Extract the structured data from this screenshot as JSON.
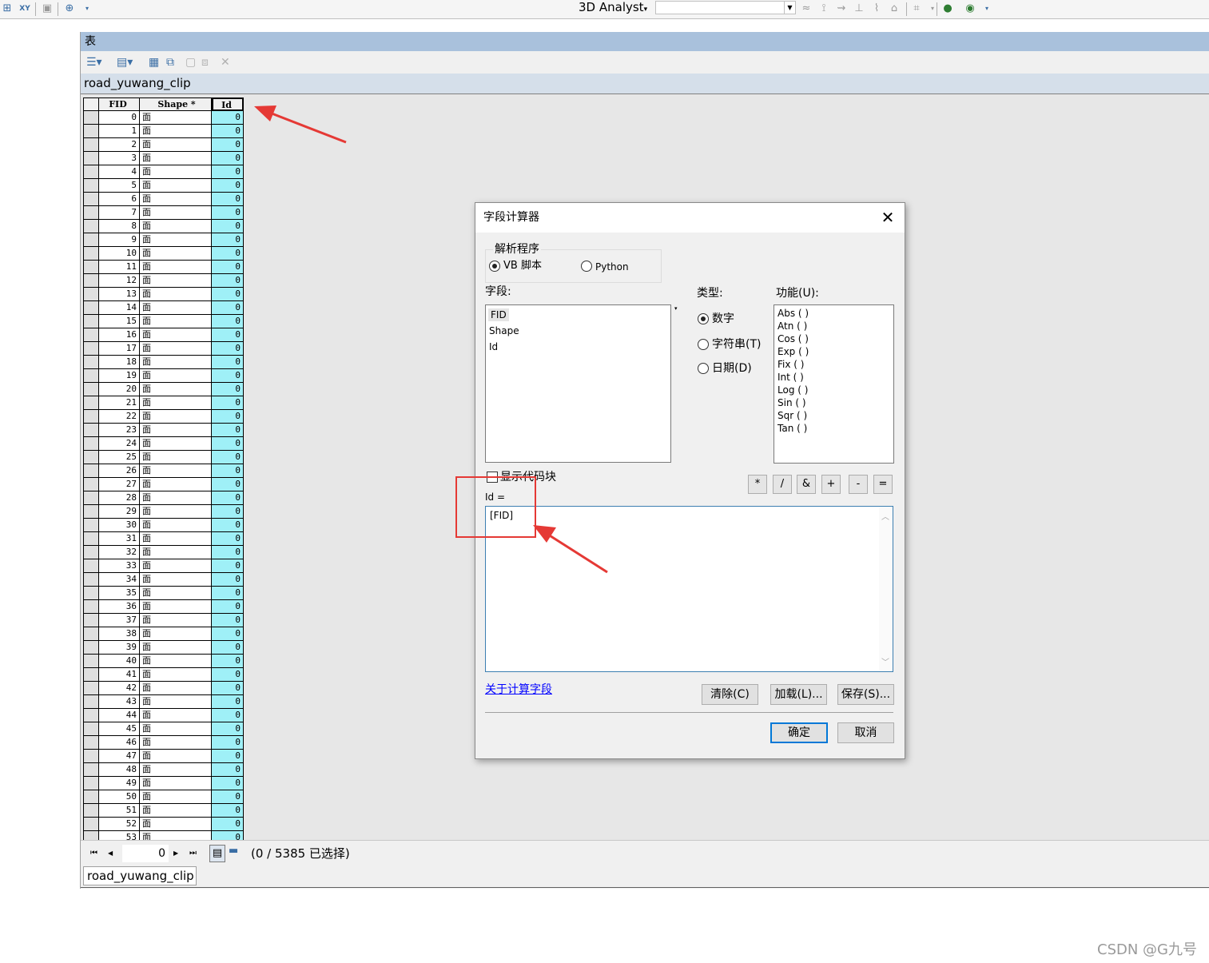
{
  "toolbar": {
    "analyst_label": "3D Analyst",
    "analyst_dropdown_arrow": "▾",
    "icons": [
      "add-xy-icon",
      "xy-icon",
      "identify-icon",
      "zoom-icon",
      "interpolate-icon",
      "globe-icon",
      "arcscene-icon"
    ]
  },
  "table_window": {
    "title": "表",
    "tab_header": "road_yuwang_clip",
    "bottom_tab": "road_yuwang_clip",
    "columns": [
      "FID",
      "Shape *",
      "Id"
    ],
    "shape_value": "面",
    "id_value": "0",
    "row_count_visible": 54,
    "nav": {
      "first": "⏮",
      "prev": "◀",
      "record": "0",
      "next": "▶",
      "last": "⏭",
      "status": "(0 / 5385 已选择)"
    }
  },
  "dialog": {
    "title": "字段计算器",
    "close_glyph": "✕",
    "parser_label": "解析程序",
    "parser_options": [
      "VB 脚本",
      "Python"
    ],
    "parser_selected": "VB 脚本",
    "fields_label": "字段:",
    "fields": [
      "FID",
      "Shape",
      "Id"
    ],
    "type_label": "类型:",
    "types": [
      "数字",
      "字符串(T)",
      "日期(D)"
    ],
    "type_selected": "数字",
    "functions_label": "功能(U):",
    "functions": [
      "Abs ( )",
      "Atn ( )",
      "Cos ( )",
      "Exp ( )",
      "Fix ( )",
      "Int ( )",
      "Log ( )",
      "Sin ( )",
      "Sqr ( )",
      "Tan ( )"
    ],
    "show_codeblock_label": "显示代码块",
    "operators": [
      "*",
      "/",
      "&",
      "+",
      "-",
      "="
    ],
    "expression_label": "Id =",
    "expression": "[FID]",
    "about_link": "关于计算字段",
    "buttons": {
      "clear": "清除(C)",
      "load": "加载(L)...",
      "save": "保存(S)...",
      "ok": "确定",
      "cancel": "取消"
    }
  },
  "annotations": {
    "arrow_color": "#e53935",
    "highlight_color": "#e53935"
  },
  "watermark": "CSDN @G九号"
}
